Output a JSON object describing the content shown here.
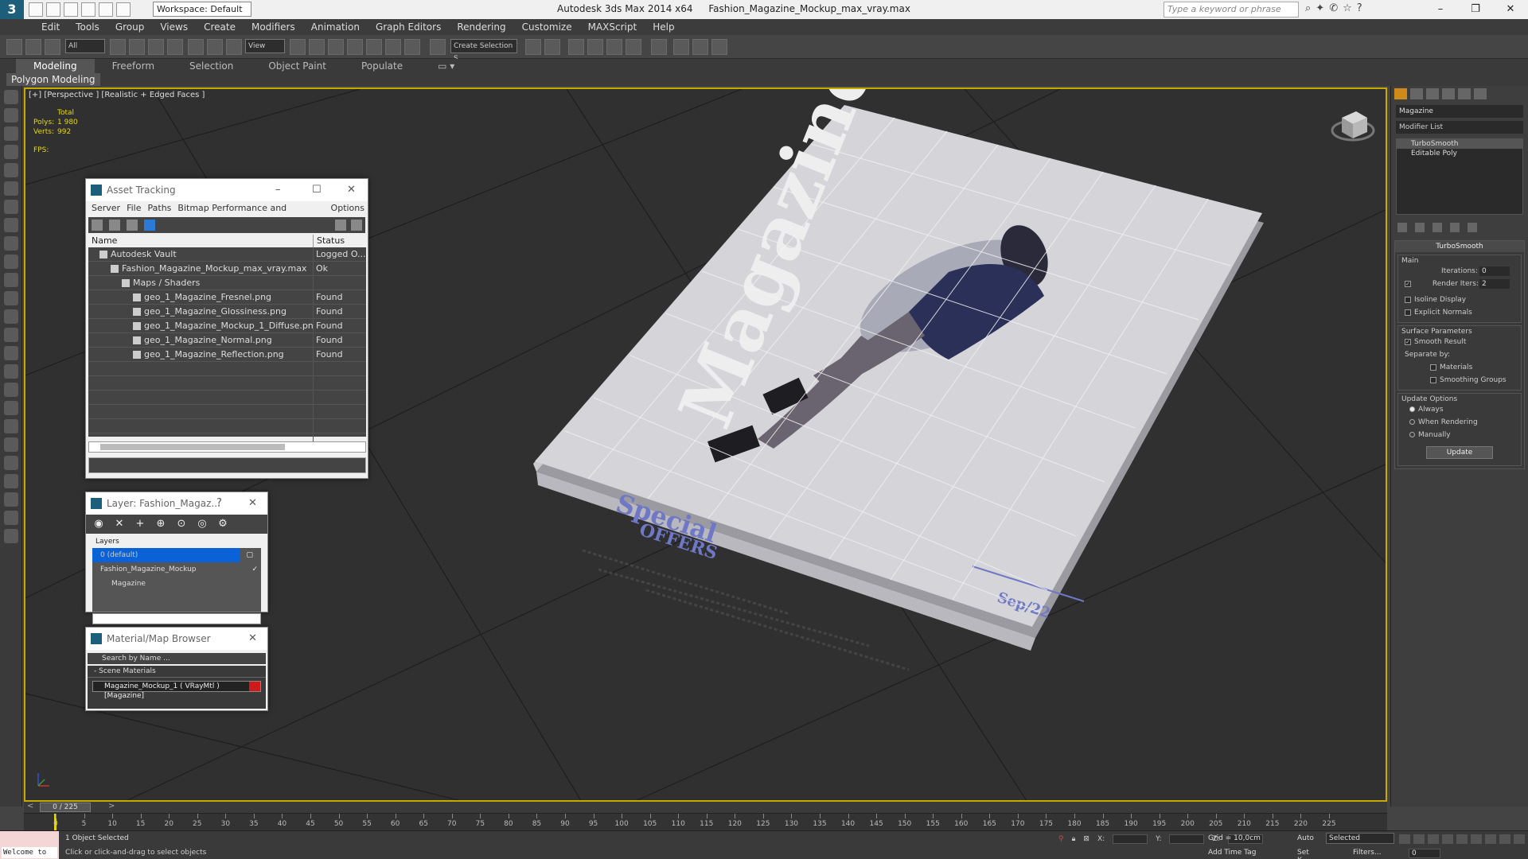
{
  "app": {
    "title": "Autodesk 3ds Max  2014 x64",
    "filename": "Fashion_Magazine_Mockup_max_vray.max",
    "workspace": "Workspace: Default",
    "search_placeholder": "Type a keyword or phrase",
    "logo": "3"
  },
  "menu": [
    "Edit",
    "Tools",
    "Group",
    "Views",
    "Create",
    "Modifiers",
    "Animation",
    "Graph Editors",
    "Rendering",
    "Customize",
    "MAXScript",
    "Help"
  ],
  "toolbar": {
    "selection_filter": "All",
    "ref_coord": "View",
    "named_selection": "Create Selection S"
  },
  "ribbon": {
    "tabs": [
      "Modeling",
      "Freeform",
      "Selection",
      "Object Paint",
      "Populate"
    ],
    "active_tab": "Modeling",
    "subpanel": "Polygon Modeling"
  },
  "viewport": {
    "label": "[+] [Perspective ] [Realistic + Edged Faces ]",
    "stats_total": "Total",
    "polys_label": "Polys:",
    "polys_value": "1 980",
    "verts_label": "Verts:",
    "verts_value": "992",
    "fps_label": "FPS:",
    "cover_title": "Magazine",
    "cover_special": "Special",
    "cover_offers": "OFFERS",
    "cover_date": "Sep/22"
  },
  "asset_tracking": {
    "title": "Asset Tracking",
    "menu": [
      "Server",
      "File",
      "Paths",
      "Bitmap Performance and Memory",
      "Options"
    ],
    "col_name": "Name",
    "col_status": "Status",
    "rows": [
      {
        "name": "Autodesk Vault",
        "status": "Logged O...",
        "indent": 14
      },
      {
        "name": "Fashion_Magazine_Mockup_max_vray.max",
        "status": "Ok",
        "indent": 28
      },
      {
        "name": "Maps / Shaders",
        "status": "",
        "indent": 42
      },
      {
        "name": "geo_1_Magazine_Fresnel.png",
        "status": "Found",
        "indent": 56
      },
      {
        "name": "geo_1_Magazine_Glossiness.png",
        "status": "Found",
        "indent": 56
      },
      {
        "name": "geo_1_Magazine_Mockup_1_Diffuse.png",
        "status": "Found",
        "indent": 56
      },
      {
        "name": "geo_1_Magazine_Normal.png",
        "status": "Found",
        "indent": 56
      },
      {
        "name": "geo_1_Magazine_Reflection.png",
        "status": "Found",
        "indent": 56
      }
    ]
  },
  "layer_explorer": {
    "title": "Layer: Fashion_Magaz...",
    "help": "?",
    "header": "Layers",
    "items": [
      {
        "name": "0 (default)",
        "selected": true
      },
      {
        "name": "Fashion_Magazine_Mockup",
        "selected": false
      },
      {
        "name": "Magazine",
        "selected": false
      }
    ]
  },
  "material_browser": {
    "title": "Material/Map Browser",
    "search_placeholder": "Search by Name ...",
    "category": "- Scene Materials",
    "material": "Magazine_Mockup_1  ( VRayMtl )  [Magazine]",
    "swatch_color": "#d01a1a"
  },
  "command_panel": {
    "object_name": "Magazine",
    "modifier_list": "Modifier List",
    "stack": [
      "TurboSmooth",
      "Editable Poly"
    ],
    "rollout_title": "TurboSmooth",
    "main_group": "Main",
    "iterations_label": "Iterations:",
    "iterations_value": "0",
    "render_iters_label": "Render Iters:",
    "render_iters_value": "2",
    "isoline": "Isoline Display",
    "explicit_normals": "Explicit Normals",
    "surface_group": "Surface Parameters",
    "smooth_result": "Smooth Result",
    "separate_by": "Separate by:",
    "materials": "Materials",
    "smoothing_groups": "Smoothing Groups",
    "update_group": "Update Options",
    "always": "Always",
    "when_rendering": "When Rendering",
    "manually": "Manually",
    "update_button": "Update"
  },
  "timeline": {
    "slider": "0 / 225",
    "ticks": [
      "0",
      "5",
      "10",
      "15",
      "20",
      "25",
      "30",
      "35",
      "40",
      "45",
      "50",
      "55",
      "60",
      "65",
      "70",
      "75",
      "80",
      "85",
      "90",
      "95",
      "100",
      "105",
      "110",
      "115",
      "120",
      "125",
      "130",
      "135",
      "140",
      "145",
      "150",
      "155",
      "160",
      "165",
      "170",
      "175",
      "180",
      "185",
      "190",
      "195",
      "200",
      "205",
      "210",
      "215",
      "220",
      "225"
    ]
  },
  "status": {
    "welcome": "Welcome to",
    "selected": "1 Object Selected",
    "prompt": "Click or click-and-drag to select objects",
    "x_label": "X:",
    "y_label": "Y:",
    "z_label": "Z:",
    "grid": "Grid = 10,0cm",
    "add_time_tag": "Add Time Tag",
    "auto": "Auto",
    "set_key": "Set K.",
    "selected_set": "Selected",
    "filters": "Filters...",
    "frame": "0"
  },
  "colors": {
    "viewport_border": "#c8a900",
    "stats": "#e8d800",
    "selection_blue": "#0a63d6",
    "cover_text": "#6f78c6"
  }
}
